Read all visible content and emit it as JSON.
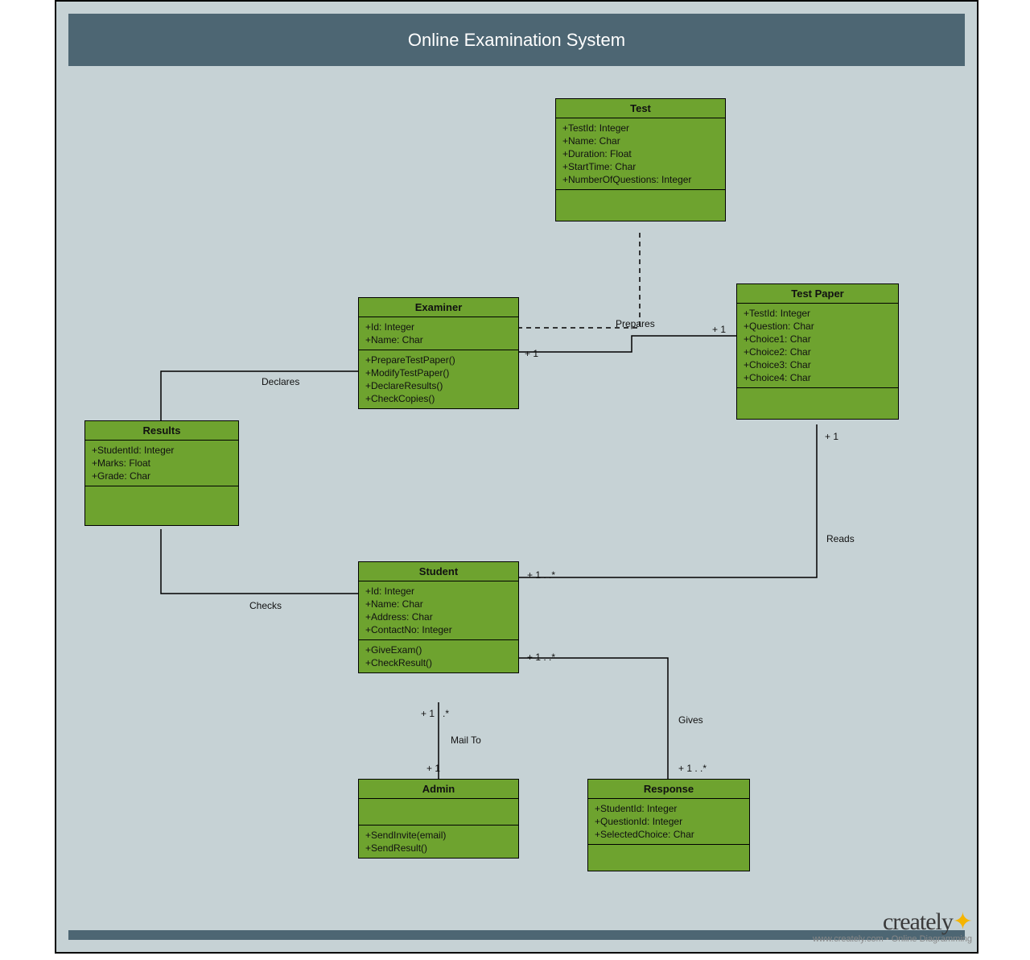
{
  "title": "Online Examination System",
  "classes": {
    "test": {
      "name": "Test",
      "attrs": [
        "+TestId: Integer",
        "+Name: Char",
        "+Duration: Float",
        "+StartTime: Char",
        "+NumberOfQuestions: Integer"
      ],
      "ops": []
    },
    "examiner": {
      "name": "Examiner",
      "attrs": [
        "+Id: Integer",
        "+Name: Char"
      ],
      "ops": [
        "+PrepareTestPaper()",
        "+ModifyTestPaper()",
        "+DeclareResults()",
        "+CheckCopies()"
      ]
    },
    "testpaper": {
      "name": "Test Paper",
      "attrs": [
        "+TestId: Integer",
        "+Question: Char",
        "+Choice1: Char",
        "+Choice2: Char",
        "+Choice3: Char",
        "+Choice4: Char"
      ],
      "ops": []
    },
    "results": {
      "name": "Results",
      "attrs": [
        "+StudentId: Integer",
        "+Marks: Float",
        "+Grade: Char"
      ],
      "ops": []
    },
    "student": {
      "name": "Student",
      "attrs": [
        "+Id: Integer",
        "+Name: Char",
        "+Address: Char",
        "+ContactNo: Integer"
      ],
      "ops": [
        "+GiveExam()",
        "+CheckResult()"
      ]
    },
    "admin": {
      "name": "Admin",
      "attrs": [],
      "ops": [
        "+SendInvite(email)",
        "+SendResult()"
      ]
    },
    "response": {
      "name": "Response",
      "attrs": [
        "+StudentId: Integer",
        "+QuestionId: Integer",
        "+SelectedChoice: Char"
      ],
      "ops": []
    }
  },
  "labels": {
    "declares": "Declares",
    "prepares": "Prepares",
    "reads": "Reads",
    "checks": "Checks",
    "mailto": "Mail To",
    "gives": "Gives",
    "m1": "+ 1",
    "m1s": "+ 1 . .*"
  },
  "logo": {
    "brand": "creately",
    "sub": "www.creately.com • Online Diagramming"
  }
}
